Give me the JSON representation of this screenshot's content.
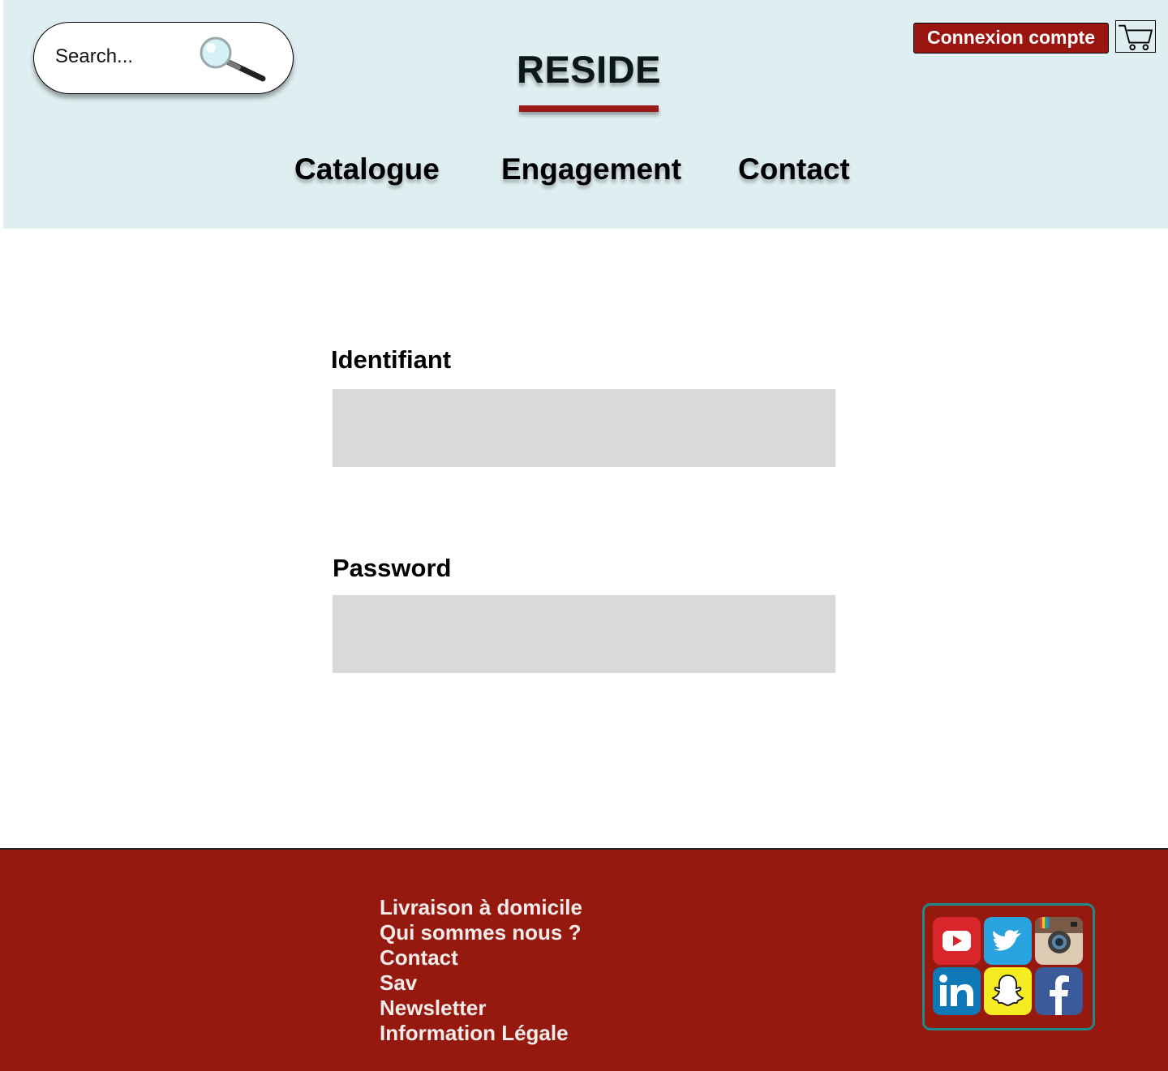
{
  "header": {
    "search": {
      "placeholder": "Search..."
    },
    "logo": "RESIDE",
    "login_button": "Connexion compte",
    "nav": [
      {
        "label": "Catalogue"
      },
      {
        "label": "Engagement"
      },
      {
        "label": "Contact"
      }
    ],
    "icons": {
      "search": "magnifying-glass-icon",
      "cart": "shopping-cart-icon"
    }
  },
  "form": {
    "identifier_label": "Identifiant",
    "identifier_value": "",
    "password_label": "Password",
    "password_value": ""
  },
  "footer": {
    "links": [
      "Livraison à domicile",
      "Qui sommes nous ?",
      "Contact",
      "Sav",
      "Newsletter",
      "Information Légale"
    ],
    "social": [
      "youtube-icon",
      "twitter-icon",
      "instagram-icon",
      "linkedin-icon",
      "snapchat-icon",
      "facebook-icon"
    ]
  },
  "colors": {
    "header_bg": "#dfeef1",
    "accent": "#9a1510",
    "footer_bg": "#961910",
    "input_bg": "#d9d9d9",
    "social_border": "#1e8b8b"
  }
}
